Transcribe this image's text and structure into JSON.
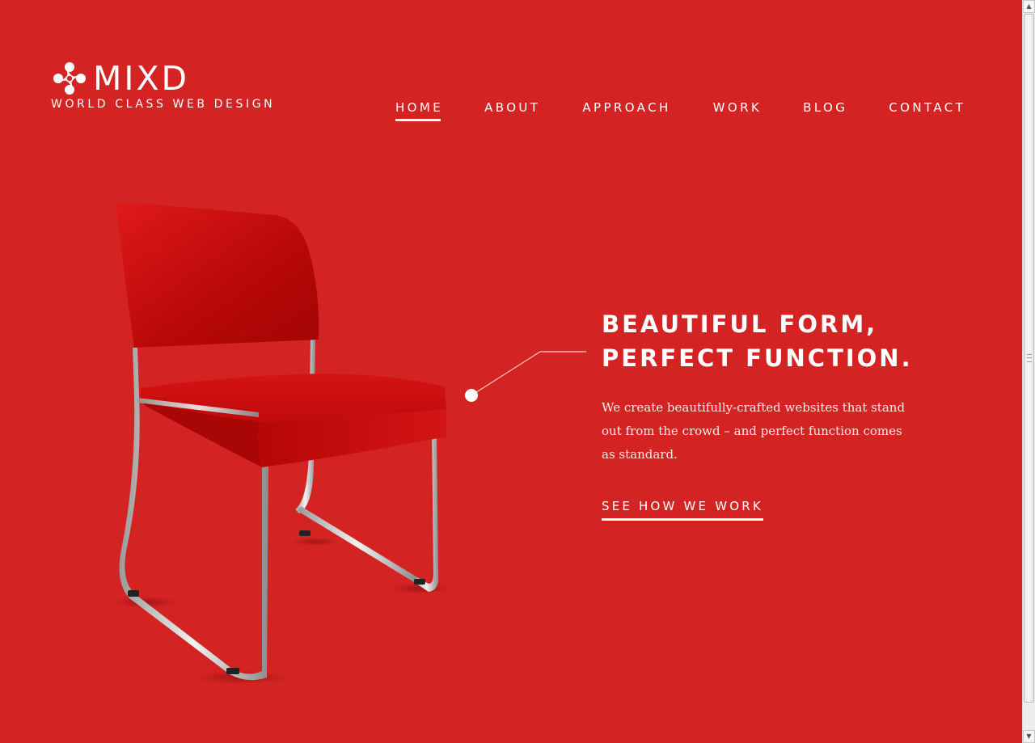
{
  "brand": {
    "name": "MIXD",
    "tagline": "WORLD CLASS WEB DESIGN",
    "logo_icon": "pinwheel-logo-icon"
  },
  "nav": {
    "items": [
      {
        "label": "HOME",
        "active": true
      },
      {
        "label": "ABOUT",
        "active": false
      },
      {
        "label": "APPROACH",
        "active": false
      },
      {
        "label": "WORK",
        "active": false
      },
      {
        "label": "BLOG",
        "active": false
      },
      {
        "label": "CONTACT",
        "active": false
      }
    ]
  },
  "hero": {
    "title_line1": "BEAUTIFUL FORM,",
    "title_line2": "PERFECT FUNCTION.",
    "body": "We create beautifully-crafted websites that stand out from the crowd – and perfect function comes as standard.",
    "cta_label": "SEE HOW WE WORK",
    "image_subject": "red-chair"
  },
  "colors": {
    "background": "#d42323",
    "text": "#ffffff"
  }
}
